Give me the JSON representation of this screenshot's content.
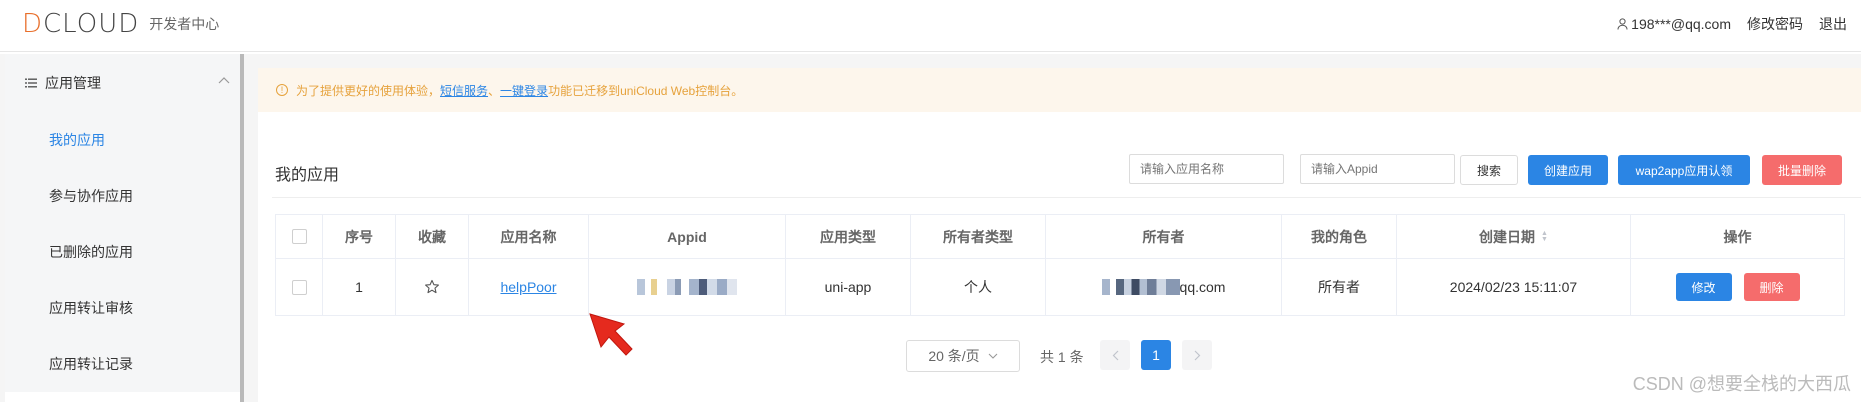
{
  "header": {
    "logo_text_d": "D",
    "logo_text_rest": "CLOUD",
    "logo_sub": "开发者中心",
    "user_email": "198***@qq.com",
    "change_password": "修改密码",
    "logout": "退出"
  },
  "sidebar": {
    "section_title": "应用管理",
    "items": [
      {
        "label": "我的应用",
        "active": true
      },
      {
        "label": "参与协作应用",
        "active": false
      },
      {
        "label": "已删除的应用",
        "active": false
      },
      {
        "label": "应用转让审核",
        "active": false
      },
      {
        "label": "应用转让记录",
        "active": false
      }
    ]
  },
  "notice": {
    "prefix": "为了提供更好的使用体验，",
    "link1": "短信服务",
    "sep": "、",
    "link2": "一键登录",
    "suffix": "功能已迁移到uniCloud Web控制台。"
  },
  "page": {
    "title": "我的应用"
  },
  "toolbar": {
    "name_placeholder": "请输入应用名称",
    "appid_placeholder": "请输入Appid",
    "search": "搜索",
    "create": "创建应用",
    "wap2app": "wap2app应用认领",
    "batch_delete": "批量删除"
  },
  "table": {
    "columns": [
      "",
      "序号",
      "收藏",
      "应用名称",
      "Appid",
      "应用类型",
      "所有者类型",
      "所有者",
      "我的角色",
      "创建日期",
      "操作"
    ],
    "rows": [
      {
        "index": "1",
        "name": "helpPoor",
        "type": "uni-app",
        "owner_type": "个人",
        "owner_suffix": "qq.com",
        "role": "所有者",
        "created": "2024/02/23 15:11:07",
        "edit": "修改",
        "delete": "删除"
      }
    ]
  },
  "pagination": {
    "page_size": "20 条/页",
    "total": "共 1 条",
    "current": "1"
  },
  "watermark": "CSDN @想要全栈的大西瓜",
  "colors": {
    "primary": "#2b85e4",
    "danger": "#f56c6c",
    "notice_bg": "#fdf6ec",
    "notice_text": "#e6a23c",
    "logo_accent": "#e86f2b"
  }
}
